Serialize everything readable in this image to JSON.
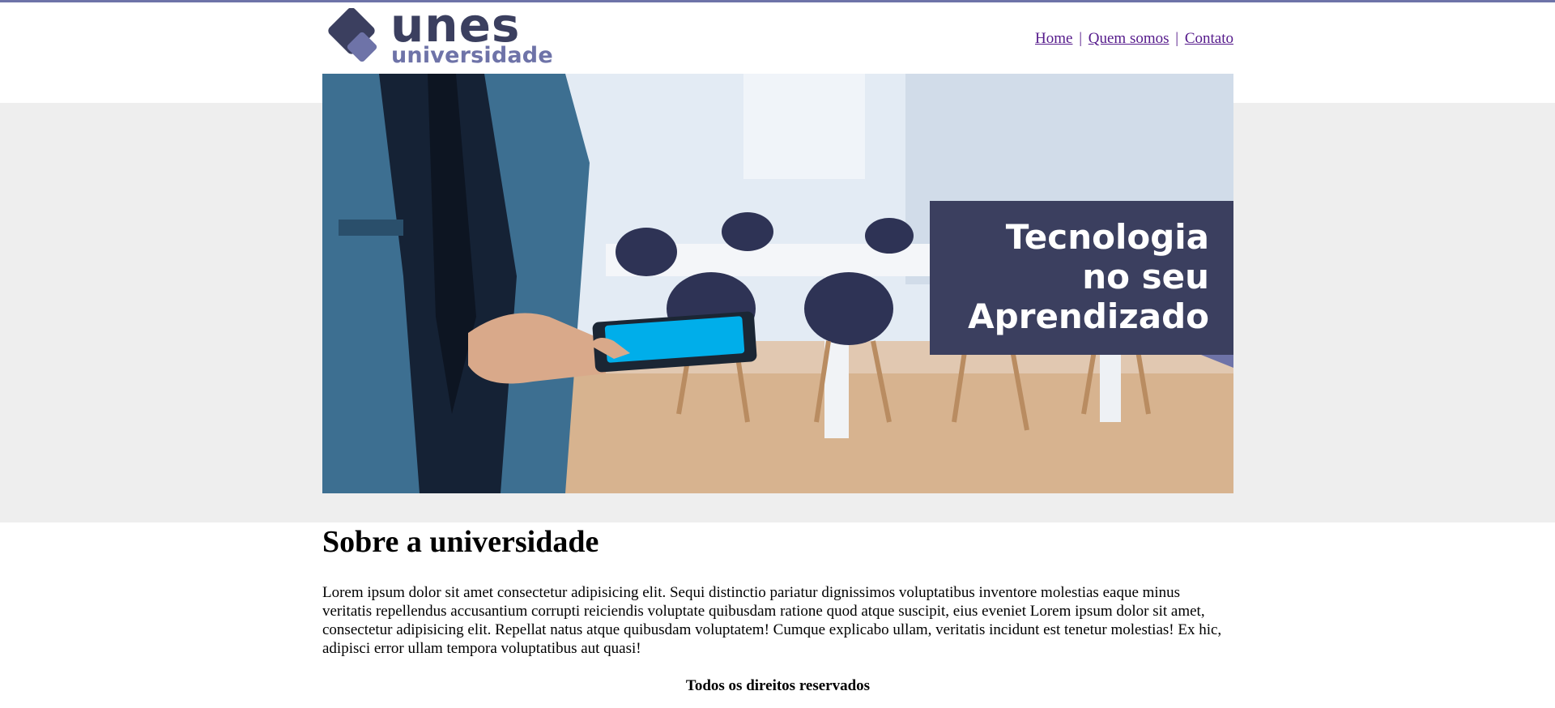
{
  "header": {
    "logo_text": "unes",
    "logo_subtext": "universidade",
    "nav": {
      "home": "Home",
      "separator": "|",
      "about": "Quem somos",
      "contact": "Contato"
    }
  },
  "banner": {
    "tag_lines": [
      "Tecnologia",
      "no seu",
      "Aprendizado"
    ]
  },
  "main": {
    "title": "Sobre a universidade",
    "body": "Lorem ipsum dolor sit amet consectetur adipisicing elit. Sequi distinctio pariatur dignissimos voluptatibus inventore molestias eaque minus veritatis repellendus accusantium corrupti reiciendis voluptate quibusdam ratione quod atque suscipit, eius eveniet Lorem ipsum dolor sit amet, consectetur adipisicing elit. Repellat natus atque quibusdam voluptatem! Cumque explicabo ullam, veritatis incidunt est tenetur molestias! Ex hic, adipisci error ullam tempora voluptatibus aut quasi!"
  },
  "footer": {
    "text": "Todos os direitos reservados"
  },
  "colors": {
    "brand_dark": "#3b3f5f",
    "brand_light": "#6e73a8",
    "band_gray": "#eeeeee",
    "link": "#551a8b"
  },
  "icons": {
    "logo": "diamond-logo-icon"
  }
}
